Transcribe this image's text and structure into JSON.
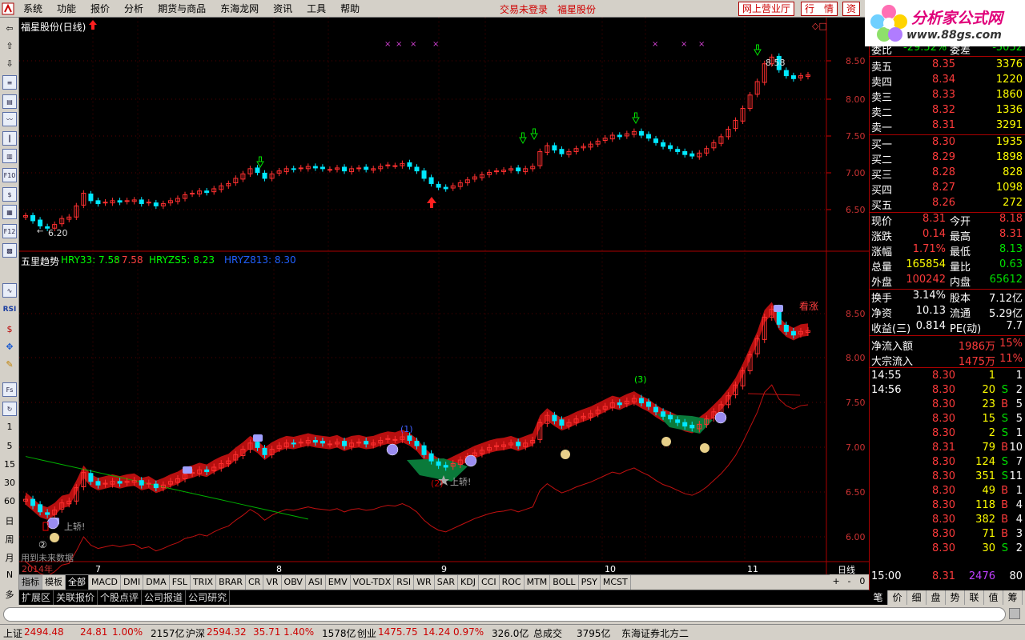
{
  "menubar": {
    "items": [
      "系统",
      "功能",
      "报价",
      "分析",
      "期货与商品",
      "东海龙网",
      "资讯",
      "工具",
      "帮助"
    ],
    "center_links": [
      "交易未登录",
      "福星股份"
    ],
    "buttons": [
      "网上营业厅",
      "行　情",
      "资"
    ]
  },
  "brand": {
    "name": "分析家公式网",
    "url": "www.88gs.com"
  },
  "left_toolbar": {
    "periods": [
      "1",
      "5",
      "15",
      "30",
      "60",
      "日",
      "周",
      "月",
      "N",
      "多"
    ],
    "labels": [
      "RSI"
    ]
  },
  "chart": {
    "title": "福星股份(日线)",
    "indicator_title": "五里趋势",
    "indicator_values": [
      {
        "label": "HRY33: 7.58",
        "color": "#00ff00"
      },
      {
        "label": ": 7.58",
        "color": "#ff4040"
      },
      {
        "label": "HRYZS5: 8.23",
        "color": "#00ff00"
      },
      {
        "label": "HRYZ813: 8.30",
        "color": "#0050ff"
      }
    ],
    "price_axis": [
      "8.50",
      "8.00",
      "7.50",
      "7.00",
      "6.50"
    ],
    "ind_axis": [
      "8.50",
      "8.00",
      "7.50",
      "7.00",
      "6.50",
      "6.00"
    ],
    "low_label": "6.20",
    "high_label": "8.58",
    "x_labels": [
      "2014年",
      "7",
      "8",
      "9",
      "10",
      "11"
    ],
    "period_label": "日线",
    "annotations": {
      "kanzhang": "看涨",
      "shangjiao": "上轿!",
      "shangjiao2": "上轿!",
      "circle2": "②",
      "c1": "(1)",
      "c2": "(2)",
      "c3": "(3)",
      "future": "用到未来数据"
    },
    "controls": [
      "+",
      "-",
      "0"
    ]
  },
  "chart_data": {
    "type": "candlestick",
    "title": "福星股份(日线)",
    "ylim": [
      6.2,
      8.6
    ],
    "x_labels": [
      "2014年",
      "7",
      "8",
      "9",
      "10",
      "11"
    ],
    "low": 6.2,
    "high": 8.58
  },
  "quote": {
    "top": {
      "label1": "委比",
      "v1": "-29.52%",
      "label2": "委差",
      "v2": "-5052"
    },
    "asks": [
      [
        "卖五",
        "8.35",
        "3376"
      ],
      [
        "卖四",
        "8.34",
        "1220"
      ],
      [
        "卖三",
        "8.33",
        "1860"
      ],
      [
        "卖二",
        "8.32",
        "1336"
      ],
      [
        "卖一",
        "8.31",
        "3291"
      ]
    ],
    "bids": [
      [
        "买一",
        "8.30",
        "1935"
      ],
      [
        "买二",
        "8.29",
        "1898"
      ],
      [
        "买三",
        "8.28",
        "828"
      ],
      [
        "买四",
        "8.27",
        "1098"
      ],
      [
        "买五",
        "8.26",
        "272"
      ]
    ],
    "stats": [
      [
        "现价",
        "8.31",
        "今开",
        "8.18"
      ],
      [
        "涨跌",
        "0.14",
        "最高",
        "8.31"
      ],
      [
        "涨幅",
        "1.71%",
        "最低",
        "8.13"
      ],
      [
        "总量",
        "165854",
        "量比",
        "0.63"
      ],
      [
        "外盘",
        "100242",
        "内盘",
        "65612"
      ]
    ],
    "stats2": [
      [
        "换手",
        "3.14%",
        "股本",
        "7.12亿"
      ],
      [
        "净资",
        "10.13",
        "流通",
        "5.29亿"
      ],
      [
        "收益(三)",
        "0.814",
        "PE(动)",
        "7.7"
      ]
    ],
    "flows": [
      [
        "净流入额",
        "1986万",
        "15%"
      ],
      [
        "大宗流入",
        "1475万",
        "11%"
      ]
    ],
    "ticks": [
      [
        "14:55",
        "8.30",
        "1",
        "",
        " 1"
      ],
      [
        "14:56",
        "8.30",
        "20",
        "S",
        "2"
      ],
      [
        "",
        "8.30",
        "23",
        "B",
        "5"
      ],
      [
        "",
        "8.30",
        "15",
        "S",
        "5"
      ],
      [
        "",
        "8.30",
        "2",
        "S",
        "1"
      ],
      [
        "",
        "8.31",
        "79",
        "B",
        "10"
      ],
      [
        "",
        "8.30",
        "124",
        "S",
        "7"
      ],
      [
        "",
        "8.30",
        "351",
        "S",
        "11"
      ],
      [
        "",
        "8.30",
        "49",
        "B",
        "1"
      ],
      [
        "",
        "8.30",
        "118",
        "B",
        "4"
      ],
      [
        "",
        "8.30",
        "382",
        "B",
        "4"
      ],
      [
        "",
        "8.30",
        "71",
        "B",
        "3"
      ],
      [
        "",
        "8.30",
        "30",
        "S",
        "2"
      ]
    ],
    "last": {
      "time": "15:00",
      "price": "8.31",
      "vol": "2476",
      "n": "80"
    }
  },
  "tabs": [
    "指标",
    "模板",
    "全部",
    "MACD",
    "DMI",
    "DMA",
    "FSL",
    "TRIX",
    "BRAR",
    "CR",
    "VR",
    "OBV",
    "ASI",
    "EMV",
    "VOL-TDX",
    "RSI",
    "WR",
    "SAR",
    "KDJ",
    "CCI",
    "ROC",
    "MTM",
    "BOLL",
    "PSY",
    "MCST"
  ],
  "subtabs": [
    "扩展区",
    "关联报价",
    "个股点评",
    "公司报道",
    "公司研究"
  ],
  "rtabs": [
    "笔",
    "价",
    "细",
    "盘",
    "势",
    "联",
    "值",
    "筹"
  ],
  "status": {
    "sh_label": "上证",
    "sh_val": "2494.48",
    "sh_chg": "24.81",
    "sh_pct": "1.00%",
    "sh_amt": "2157亿",
    "hs_label": "沪深",
    "hs_val": "2594.32",
    "hs_chg": "35.71",
    "hs_pct": "1.40%",
    "hs_amt": "1578亿",
    "cy_label": "创业",
    "cy_val": "1475.75",
    "cy_chg": "14.24",
    "cy_pct": "0.97%",
    "cy_amt": "326.0亿",
    "total_label": "总成交",
    "total_amt": "3795亿",
    "broker": "东海证券北方二"
  }
}
